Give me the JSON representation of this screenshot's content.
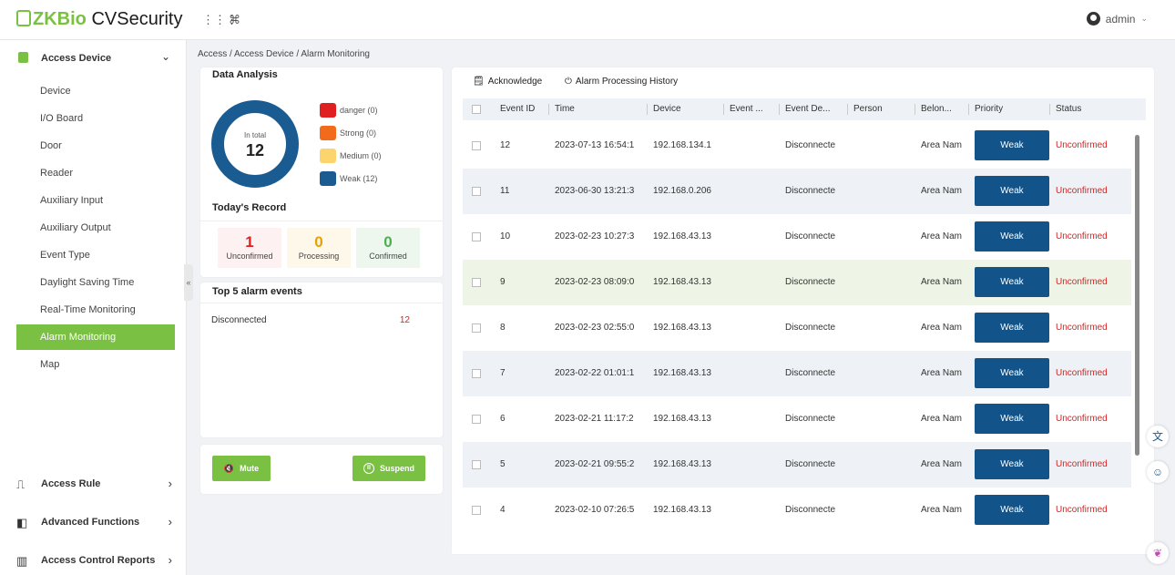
{
  "app": {
    "logo_zk": "ZKBio",
    "logo_rest": " CVSecurity",
    "user": "admin"
  },
  "colors": {
    "brand_green": "#7ac143",
    "priority_blue": "#12538a",
    "status_red": "#e02020"
  },
  "sidebar": {
    "header": "Access Device",
    "items": [
      {
        "label": "Device"
      },
      {
        "label": "I/O Board"
      },
      {
        "label": "Door"
      },
      {
        "label": "Reader"
      },
      {
        "label": "Auxiliary Input"
      },
      {
        "label": "Auxiliary Output"
      },
      {
        "label": "Event Type"
      },
      {
        "label": "Daylight Saving Time"
      },
      {
        "label": "Real-Time Monitoring"
      },
      {
        "label": "Alarm Monitoring",
        "active": true
      },
      {
        "label": "Map"
      }
    ],
    "sections": [
      {
        "label": "Access Rule",
        "icon": "door-icon"
      },
      {
        "label": "Advanced Functions",
        "icon": "advanced-icon"
      },
      {
        "label": "Access Control Reports",
        "icon": "report-icon"
      }
    ]
  },
  "breadcrumb": "Access / Access Device / Alarm Monitoring",
  "data_analysis": {
    "title": "Data Analysis",
    "total_label": "In total",
    "total": "12",
    "legend": [
      {
        "label": "danger (0)",
        "color": "#e02020"
      },
      {
        "label": "Strong (0)",
        "color": "#f26a1b"
      },
      {
        "label": "Medium (0)",
        "color": "#fbd46d"
      },
      {
        "label": "Weak (12)",
        "color": "#1a5b92"
      }
    ]
  },
  "todays_record": {
    "title": "Today's Record",
    "items": [
      {
        "value": "1",
        "label": "Unconfirmed",
        "color": "#e02020",
        "bg": "#fdf1f1"
      },
      {
        "value": "0",
        "label": "Processing",
        "color": "#e8a100",
        "bg": "#fdf8ea"
      },
      {
        "value": "0",
        "label": "Confirmed",
        "color": "#4caf50",
        "bg": "#eef7ee"
      }
    ]
  },
  "top5": {
    "title": "Top 5 alarm events",
    "rows": [
      {
        "name": "Disconnected",
        "count": "12"
      }
    ]
  },
  "actions": {
    "mute": "Mute",
    "suspend": "Suspend"
  },
  "toolbar": {
    "acknowledge": "Acknowledge",
    "history": "Alarm Processing History"
  },
  "table": {
    "headers": [
      "Event ID",
      "Time",
      "Device",
      "Event ...",
      "Event De...",
      "Person",
      "Belon...",
      "Priority",
      "Status"
    ],
    "rows": [
      {
        "id": "12",
        "time": "2023-07-13 16:54:1",
        "device": "192.168.134.1",
        "desc": "Disconnecte",
        "area": "Area Nam",
        "priority": "Weak",
        "status": "Unconfirmed"
      },
      {
        "id": "11",
        "time": "2023-06-30 13:21:3",
        "device": "192.168.0.206",
        "desc": "Disconnecte",
        "area": "Area Nam",
        "priority": "Weak",
        "status": "Unconfirmed"
      },
      {
        "id": "10",
        "time": "2023-02-23 10:27:3",
        "device": "192.168.43.13",
        "desc": "Disconnecte",
        "area": "Area Nam",
        "priority": "Weak",
        "status": "Unconfirmed"
      },
      {
        "id": "9",
        "time": "2023-02-23 08:09:0",
        "device": "192.168.43.13",
        "desc": "Disconnecte",
        "area": "Area Nam",
        "priority": "Weak",
        "status": "Unconfirmed"
      },
      {
        "id": "8",
        "time": "2023-02-23 02:55:0",
        "device": "192.168.43.13",
        "desc": "Disconnecte",
        "area": "Area Nam",
        "priority": "Weak",
        "status": "Unconfirmed"
      },
      {
        "id": "7",
        "time": "2023-02-22 01:01:1",
        "device": "192.168.43.13",
        "desc": "Disconnecte",
        "area": "Area Nam",
        "priority": "Weak",
        "status": "Unconfirmed"
      },
      {
        "id": "6",
        "time": "2023-02-21 11:17:2",
        "device": "192.168.43.13",
        "desc": "Disconnecte",
        "area": "Area Nam",
        "priority": "Weak",
        "status": "Unconfirmed"
      },
      {
        "id": "5",
        "time": "2023-02-21 09:55:2",
        "device": "192.168.43.13",
        "desc": "Disconnecte",
        "area": "Area Nam",
        "priority": "Weak",
        "status": "Unconfirmed"
      },
      {
        "id": "4",
        "time": "2023-02-10 07:26:5",
        "device": "192.168.43.13",
        "desc": "Disconnecte",
        "area": "Area Nam",
        "priority": "Weak",
        "status": "Unconfirmed"
      }
    ]
  }
}
